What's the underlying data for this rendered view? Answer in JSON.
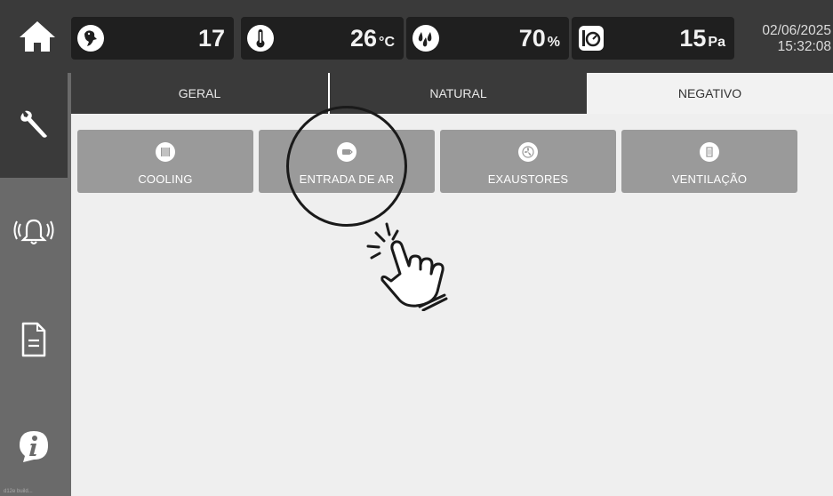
{
  "header": {
    "stats": [
      {
        "icon": "bird-icon",
        "value": "17",
        "unit": ""
      },
      {
        "icon": "thermometer-icon",
        "value": "26",
        "unit": "°C"
      },
      {
        "icon": "humidity-drops-icon",
        "value": "70",
        "unit": "%"
      },
      {
        "icon": "pressure-gauge-icon",
        "value": "15",
        "unit": "Pa"
      }
    ],
    "date": "02/06/2025",
    "time": "15:32:08"
  },
  "sidebar": {
    "items": [
      {
        "name": "settings",
        "icon": "wrench-icon",
        "active": true
      },
      {
        "name": "alarms",
        "icon": "bell-icon",
        "active": false
      },
      {
        "name": "reports",
        "icon": "document-icon",
        "active": false
      },
      {
        "name": "info",
        "icon": "info-icon",
        "active": false
      }
    ],
    "version": "d12e build..."
  },
  "tabs": [
    {
      "label": "GERAL",
      "selected": false
    },
    {
      "label": "NATURAL",
      "selected": false
    },
    {
      "label": "NEGATIVO",
      "selected": true
    }
  ],
  "buttons": [
    {
      "label": "COOLING",
      "icon": "cooling-pad-icon"
    },
    {
      "label": "ENTRADA DE AR",
      "icon": "air-inlet-icon"
    },
    {
      "label": "EXAUSTORES",
      "icon": "fan-icon"
    },
    {
      "label": "VENTILAÇÃO",
      "icon": "ventilation-icon"
    }
  ],
  "colors": {
    "topbar": "#3a3a3a",
    "statBox": "#1f1f1f",
    "sidebar": "#6a6a6a",
    "button": "#9a9a9a",
    "background": "#efefef"
  }
}
